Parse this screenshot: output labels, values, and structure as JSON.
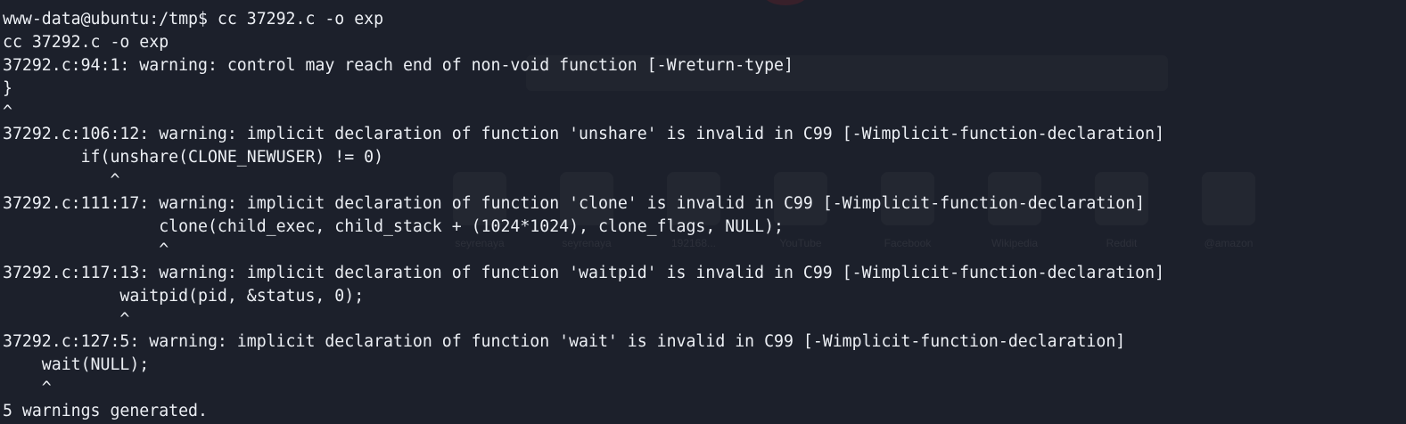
{
  "terminal": {
    "lines": [
      "www-data@ubuntu:/tmp$ cc 37292.c -o exp",
      "cc 37292.c -o exp",
      "37292.c:94:1: warning: control may reach end of non-void function [-Wreturn-type]",
      "}",
      "^",
      "37292.c:106:12: warning: implicit declaration of function 'unshare' is invalid in C99 [-Wimplicit-function-declaration]",
      "        if(unshare(CLONE_NEWUSER) != 0)",
      "           ^",
      "37292.c:111:17: warning: implicit declaration of function 'clone' is invalid in C99 [-Wimplicit-function-declaration]",
      "                clone(child_exec, child_stack + (1024*1024), clone_flags, NULL);",
      "                ^",
      "37292.c:117:13: warning: implicit declaration of function 'waitpid' is invalid in C99 [-Wimplicit-function-declaration]",
      "            waitpid(pid, &status, 0);",
      "            ^",
      "37292.c:127:5: warning: implicit declaration of function 'wait' is invalid in C99 [-Wimplicit-function-declaration]",
      "    wait(NULL);",
      "    ^",
      "5 warnings generated."
    ]
  },
  "background_shortcuts": [
    {
      "label": "seyrenaya",
      "icon": "shortcut-tile-icon"
    },
    {
      "label": "seyrenaya",
      "icon": "shortcut-tile-icon"
    },
    {
      "label": "192168...",
      "icon": "shortcut-tile-icon"
    },
    {
      "label": "YouTube",
      "icon": "youtube-icon"
    },
    {
      "label": "Facebook",
      "icon": "facebook-icon"
    },
    {
      "label": "Wikipedia",
      "icon": "wikipedia-icon"
    },
    {
      "label": "Reddit",
      "icon": "reddit-icon"
    },
    {
      "label": "@amazon",
      "icon": "amazon-icon"
    }
  ],
  "colors": {
    "terminal_background": "#1c202b",
    "terminal_foreground": "#eceff4"
  }
}
